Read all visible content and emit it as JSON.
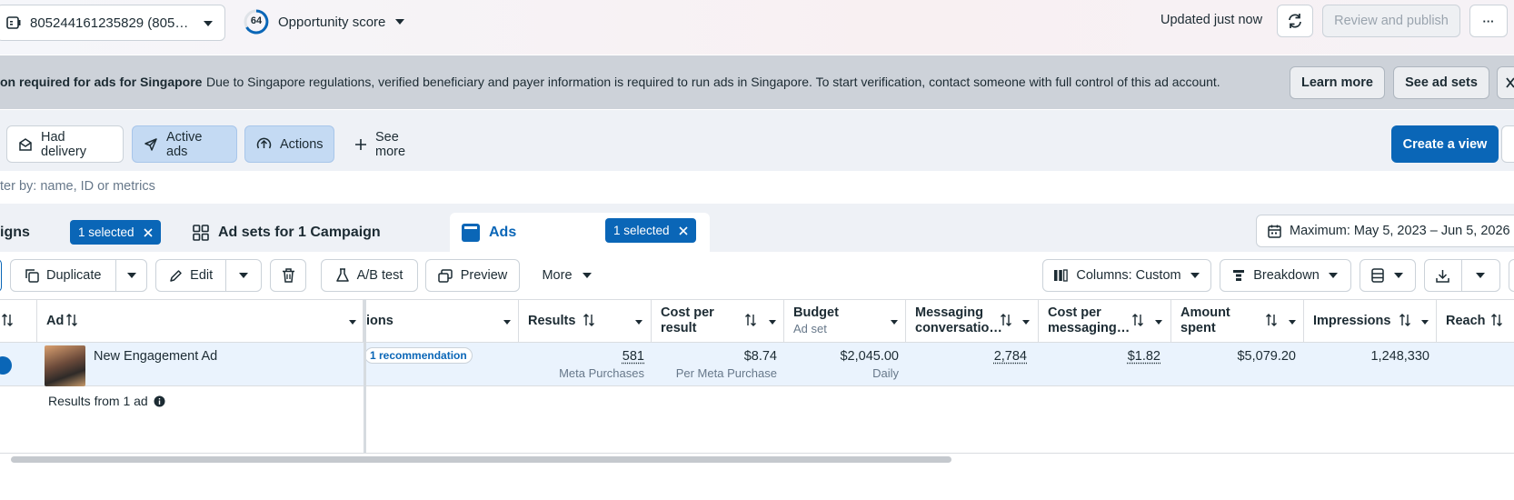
{
  "topbar": {
    "account_label": "805244161235829 (805…",
    "score_value": "64",
    "score_label": "Opportunity score",
    "updated_text": "Updated just now",
    "review_publish_label": "Review and publish",
    "more_label": "···"
  },
  "banner": {
    "title": "on required for ads for Singapore",
    "message": "Due to Singapore regulations, verified beneficiary and payer information is required to run ads in Singapore. To start verification, contact someone with full control of this ad account.",
    "learn_more_label": "Learn more",
    "see_ad_sets_label": "See ad sets",
    "close_label": "X"
  },
  "filters": {
    "had_delivery": "Had delivery",
    "active_ads": "Active ads",
    "actions": "Actions",
    "see_more": "See more",
    "create_view": "Create a view"
  },
  "search": {
    "placeholder": "ter by: name, ID or metrics"
  },
  "tabs": {
    "campaigns_label": "igns",
    "campaigns_selected": "1 selected",
    "adsets_label": "Ad sets for 1 Campaign",
    "ads_label": "Ads",
    "ads_selected": "1 selected",
    "date_range": "Maximum: May 5, 2023 – Jun 5, 2026"
  },
  "toolbar": {
    "duplicate": "Duplicate",
    "edit": "Edit",
    "ab_test": "A/B test",
    "preview": "Preview",
    "more": "More",
    "columns": "Columns: Custom",
    "breakdown": "Breakdown"
  },
  "table": {
    "headers": {
      "ad": "Ad",
      "actions": "ions",
      "results": "Results",
      "cost_per_result_1": "Cost per",
      "cost_per_result_2": "result",
      "budget": "Budget",
      "budget_sub": "Ad set",
      "messaging_1": "Messaging",
      "messaging_2": "conversatio…",
      "cost_msg_1": "Cost per",
      "cost_msg_2": "messaging…",
      "amount_1": "Amount",
      "amount_2": "spent",
      "impressions": "Impressions",
      "reach": "Reach"
    },
    "row": {
      "ad_name": "New Engagement Ad",
      "recommendation": "1 recommendation",
      "results": "581",
      "results_sub": "Meta Purchases",
      "cost_per_result": "$8.74",
      "cost_per_result_sub": "Per Meta Purchase",
      "budget": "$2,045.00",
      "budget_sub": "Daily",
      "messaging": "2,784",
      "cost_messaging": "$1.82",
      "amount_spent": "$5,079.20",
      "impressions": "1,248,330"
    },
    "summary": "Results from 1 ad"
  },
  "colors": {
    "accent": "#0a66b7",
    "pill_bg": "#c4daf3",
    "banner_bg": "#cdd2d9"
  }
}
